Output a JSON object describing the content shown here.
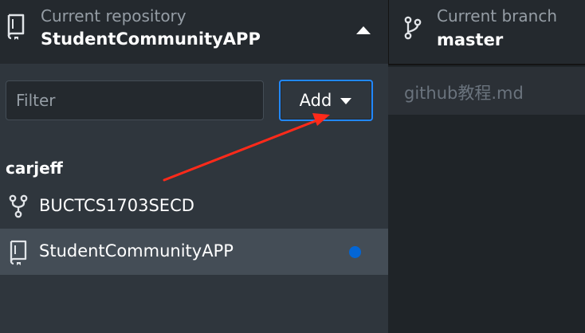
{
  "repository_header": {
    "label": "Current repository",
    "value": "StudentCommunityAPP",
    "icon": "repo-book-icon",
    "toggle_icon": "triangle-up-icon"
  },
  "filter": {
    "placeholder": "Filter",
    "value": ""
  },
  "add_button": {
    "label": "Add",
    "icon": "caret-down-icon",
    "accent_color": "#2188ff"
  },
  "repository_list": {
    "group_name": "carjeff",
    "items": [
      {
        "label": "BUCTCS1703SECD",
        "icon": "repo-forked-icon",
        "selected": false,
        "has_changes": false
      },
      {
        "label": "StudentCommunityAPP",
        "icon": "repo-book-icon",
        "selected": true,
        "has_changes": true
      }
    ]
  },
  "branch_header": {
    "label": "Current branch",
    "value": "master",
    "icon": "git-branch-icon"
  },
  "changed_file": {
    "name": "github教程.md"
  },
  "annotation": {
    "type": "arrow",
    "color": "#ff2a1a"
  },
  "colors": {
    "panel_background": "#2f363d",
    "header_background": "#24292e",
    "selected_row": "#444d56",
    "changes_dot": "#0366d6"
  }
}
